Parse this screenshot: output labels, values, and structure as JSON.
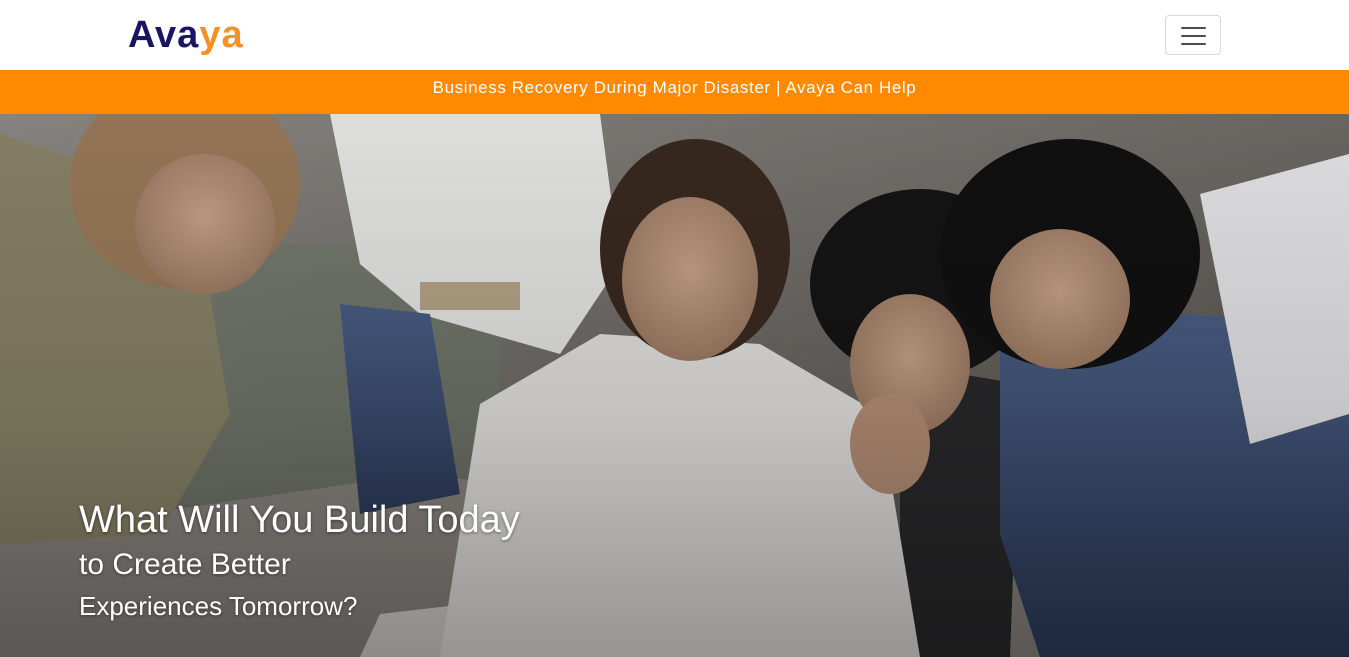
{
  "brand": {
    "part1": "Ava",
    "part2": "ya"
  },
  "navbar": {
    "toggler_icon": "hamburger-menu-icon"
  },
  "announcement": {
    "text": "Business Recovery During Major Disaster | Avaya Can Help"
  },
  "hero": {
    "line1": "What Will You Build Today",
    "line2": "to Create Better",
    "line3": "Experiences Tomorrow?"
  },
  "colors": {
    "brand_navy": "#1a1464",
    "brand_orange": "#f39220",
    "announcement_bg": "#ff8a00"
  }
}
